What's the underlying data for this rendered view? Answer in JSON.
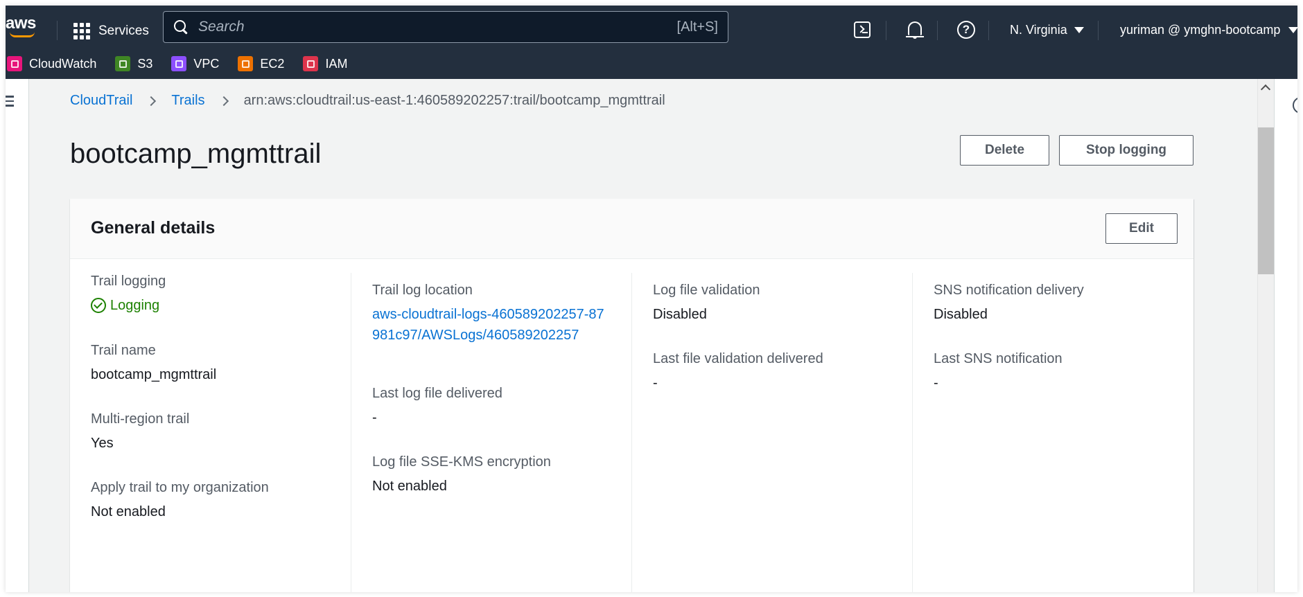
{
  "topnav": {
    "logo": "aws",
    "services_label": "Services",
    "search": {
      "placeholder": "Search",
      "shortcut": "[Alt+S]"
    },
    "icons": [
      "cloudshell-icon",
      "bell-icon",
      "help-icon"
    ],
    "region": "N. Virginia",
    "account": "yuriman @ ymghn-bootcamp"
  },
  "favorites": [
    {
      "label": "CloudWatch",
      "color": "#e7157b"
    },
    {
      "label": "S3",
      "color": "#3f8624"
    },
    {
      "label": "VPC",
      "color": "#8c4fff"
    },
    {
      "label": "EC2",
      "color": "#ed7100"
    },
    {
      "label": "IAM",
      "color": "#dd344c"
    }
  ],
  "breadcrumb": {
    "items": [
      "CloudTrail",
      "Trails"
    ],
    "current": "arn:aws:cloudtrail:us-east-1:460589202257:trail/bootcamp_mgmttrail"
  },
  "page": {
    "title": "bootcamp_mgmttrail",
    "delete_label": "Delete",
    "stop_logging_label": "Stop logging"
  },
  "general_details": {
    "title": "General details",
    "edit_label": "Edit",
    "col1": {
      "trail_logging": {
        "label": "Trail logging",
        "value": "Logging"
      },
      "trail_name": {
        "label": "Trail name",
        "value": "bootcamp_mgmttrail"
      },
      "multi_region": {
        "label": "Multi-region trail",
        "value": "Yes"
      },
      "apply_org": {
        "label": "Apply trail to my organization",
        "value": "Not enabled"
      }
    },
    "col2": {
      "log_location": {
        "label": "Trail log location",
        "value": "aws-cloudtrail-logs-460589202257-87981c97/AWSLogs/460589202257"
      },
      "last_delivered": {
        "label": "Last log file delivered",
        "value": "-"
      },
      "sse_kms": {
        "label": "Log file SSE-KMS encryption",
        "value": "Not enabled"
      }
    },
    "col3": {
      "validation": {
        "label": "Log file validation",
        "value": "Disabled"
      },
      "last_validation": {
        "label": "Last file validation delivered",
        "value": "-"
      }
    },
    "col4": {
      "sns_delivery": {
        "label": "SNS notification delivery",
        "value": "Disabled"
      },
      "last_sns": {
        "label": "Last SNS notification",
        "value": "-"
      }
    }
  },
  "colors": {
    "nav_bg": "#232f3e",
    "link": "#0972d3",
    "success": "#1d8102",
    "page_bg": "#f2f3f3"
  }
}
